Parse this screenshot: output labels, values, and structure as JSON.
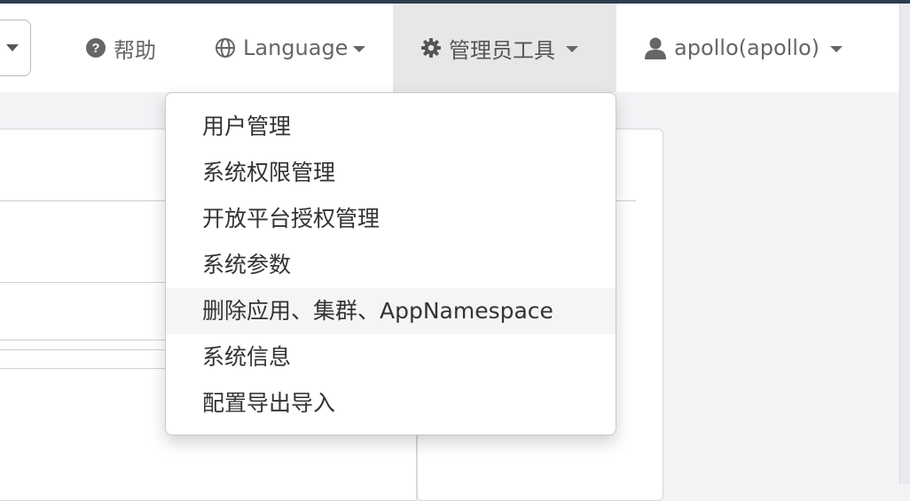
{
  "navbar": {
    "help_label": "帮助",
    "language_label": "Language",
    "admin_tools_label": "管理员工具",
    "user_label": "apollo(apollo)"
  },
  "icons": {
    "help": "question-circle-icon",
    "language": "globe-icon",
    "admin": "gear-icon",
    "user": "user-icon"
  },
  "admin_menu": {
    "items": [
      {
        "label": "用户管理"
      },
      {
        "label": "系统权限管理"
      },
      {
        "label": "开放平台授权管理"
      },
      {
        "label": "系统参数"
      },
      {
        "label": "删除应用、集群、AppNamespace"
      },
      {
        "label": "系统信息"
      },
      {
        "label": "配置导出导入"
      }
    ],
    "hovered_item": "删除应用、集群、AppNamespace"
  },
  "colors": {
    "top_accent": "#2d3e50",
    "navbar_bg": "#ffffff",
    "active_nav_bg": "#e7e7e7",
    "page_bg": "#f3f3f6",
    "hover_bg": "#f5f5f5"
  }
}
